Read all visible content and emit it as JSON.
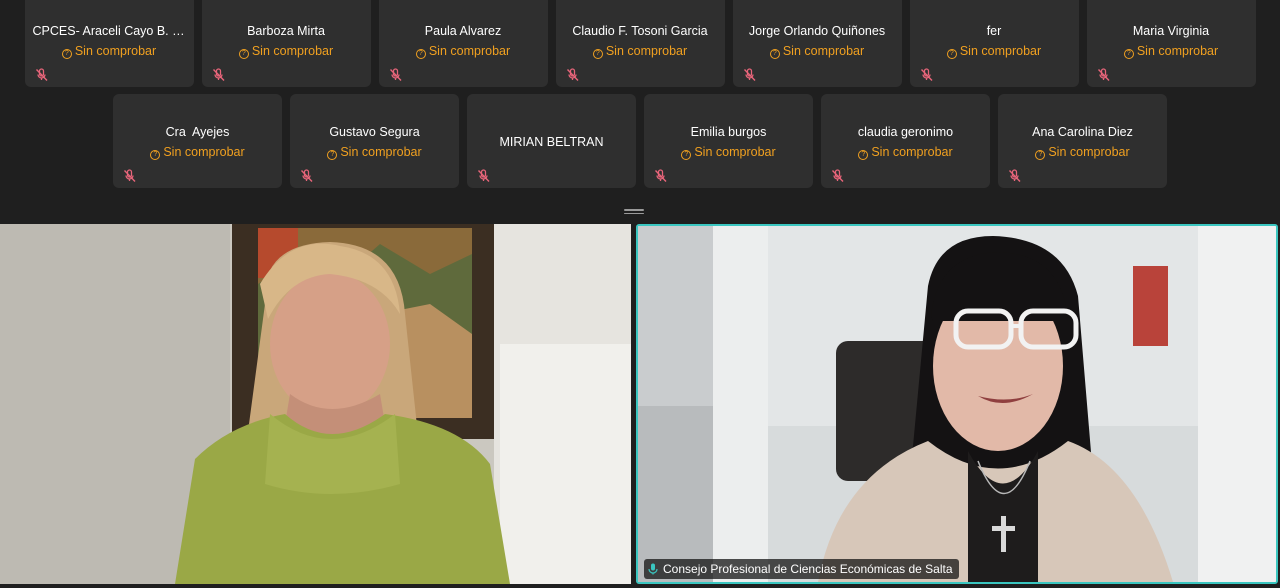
{
  "participants_row1": [
    {
      "name": "CPCES- Araceli Cayo B. Gon...",
      "status": "Sin comprobar"
    },
    {
      "name": "Barboza Mirta",
      "status": "Sin comprobar"
    },
    {
      "name": "Paula Alvarez",
      "status": "Sin comprobar"
    },
    {
      "name": "Claudio F. Tosoni Garcia",
      "status": "Sin comprobar"
    },
    {
      "name": "Jorge Orlando Quiñones",
      "status": "Sin comprobar"
    },
    {
      "name": "fer",
      "status": "Sin comprobar"
    },
    {
      "name": "Maria Virginia",
      "status": "Sin comprobar"
    }
  ],
  "participants_row2": [
    {
      "name": "Cra  Ayejes",
      "status": "Sin comprobar"
    },
    {
      "name": "Gustavo Segura",
      "status": "Sin comprobar"
    },
    {
      "name": "MIRIAN BELTRAN",
      "status": ""
    },
    {
      "name": "Emilia burgos",
      "status": "Sin comprobar"
    },
    {
      "name": "claudia geronimo",
      "status": "Sin comprobar"
    },
    {
      "name": "Ana Carolina Diez",
      "status": "Sin comprobar"
    }
  ],
  "icons": {
    "muted_mic": "mic-off-icon",
    "status": "question-circle-icon",
    "active_mic": "mic-on-icon",
    "splitter": "drag-handle-icon"
  },
  "colors": {
    "status": "#f0a020",
    "muted_icon": "#e8657a",
    "active_speaker_border": "#3ac6c0",
    "active_mic": "#3ac6c0"
  },
  "main_videos": {
    "left": {
      "label": ""
    },
    "right": {
      "label": "Consejo Profesional de Ciencias Económicas de Salta"
    }
  }
}
